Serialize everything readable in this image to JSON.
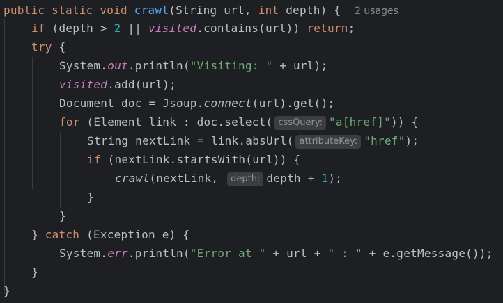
{
  "colors": {
    "background": "#1e1f22",
    "default_text": "#bcbec4",
    "keyword": "#cf8e6d",
    "method_declaration": "#56a8f5",
    "number": "#2aacb8",
    "string": "#6aab73",
    "static_field": "#c77dbb",
    "hint_text": "#868a91",
    "hint_background": "#3b3d41"
  },
  "code": {
    "usage_hint": "2 usages",
    "line1": {
      "kw1": "public static void",
      "method": "crawl",
      "params_a": "(String url, ",
      "kw2": "int",
      "params_b": " depth) {"
    },
    "line2": {
      "kw_if": "if",
      "text_a": " (depth > ",
      "num": "2",
      "text_b": " || ",
      "field": "visited",
      "text_c": ".contains(url)) ",
      "kw_return": "return",
      "text_d": ";"
    },
    "line3": {
      "kw_try": "try",
      "text": " {"
    },
    "line4": {
      "text_a": "System.",
      "field": "out",
      "text_b": ".println(",
      "str": "\"Visiting: \"",
      "text_c": " + url);"
    },
    "line5": {
      "field": "visited",
      "text": ".add(url);"
    },
    "line6": {
      "text_a": "Document doc = Jsoup.",
      "static_call": "connect",
      "text_b": "(url).get();"
    },
    "line7": {
      "kw_for": "for",
      "text_a": " (Element link : doc.select(",
      "hint": "cssQuery:",
      "str": "\"a[href]\"",
      "text_b": ")) {"
    },
    "line8": {
      "text_a": "String nextLink = link.absUrl(",
      "hint": "attributeKey:",
      "str": "\"href\"",
      "text_b": ");"
    },
    "line9": {
      "kw_if": "if",
      "text": " (nextLink.startsWith(url)) {"
    },
    "line10": {
      "static_call": "crawl",
      "text_a": "(nextLink, ",
      "hint": "depth:",
      "text_b": "depth + ",
      "num": "1",
      "text_c": ");"
    },
    "line11": {
      "text": "}"
    },
    "line12": {
      "text": "}"
    },
    "line13": {
      "text_a": "} ",
      "kw_catch": "catch",
      "text_b": " (Exception e) {"
    },
    "line14": {
      "text_a": "System.",
      "field": "err",
      "text_b": ".println(",
      "str_a": "\"Error at \"",
      "text_c": " + url + ",
      "str_b": "\" : \"",
      "text_d": " + e.getMessage());"
    },
    "line15": {
      "text": "}"
    },
    "line16": {
      "text": "}"
    }
  }
}
